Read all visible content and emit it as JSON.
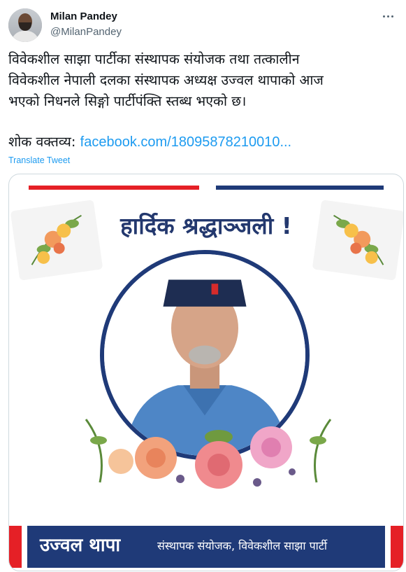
{
  "author": {
    "display_name": "Milan Pandey",
    "handle": "@MilanPandey"
  },
  "tweet": {
    "lines": [
      "विवेकशील साझा पार्टीका संस्थापक संयोजक तथा तत्कालीन",
      "विवेकशील नेपाली दलका संस्थापक अध्यक्ष उज्वल थापाको आज",
      "भएको निधनले सिङ्गो पार्टीपंक्ति स्तब्ध भएको छ।"
    ],
    "link_prefix": "शोक वक्तव्य: ",
    "link_text": "facebook.com/18095878210010...",
    "translate_label": "Translate Tweet"
  },
  "card": {
    "headline": "हार्दिक श्रद्धाञ्जली !",
    "banner_name": "उज्वल थापा",
    "banner_title": "संस्थापक संयोजक, विवेकशील साझा पार्टी"
  },
  "colors": {
    "link": "#1d9bf0",
    "brand_red": "#e52026",
    "brand_blue": "#1f3a78"
  },
  "icons": {
    "more": "more-options-icon"
  }
}
